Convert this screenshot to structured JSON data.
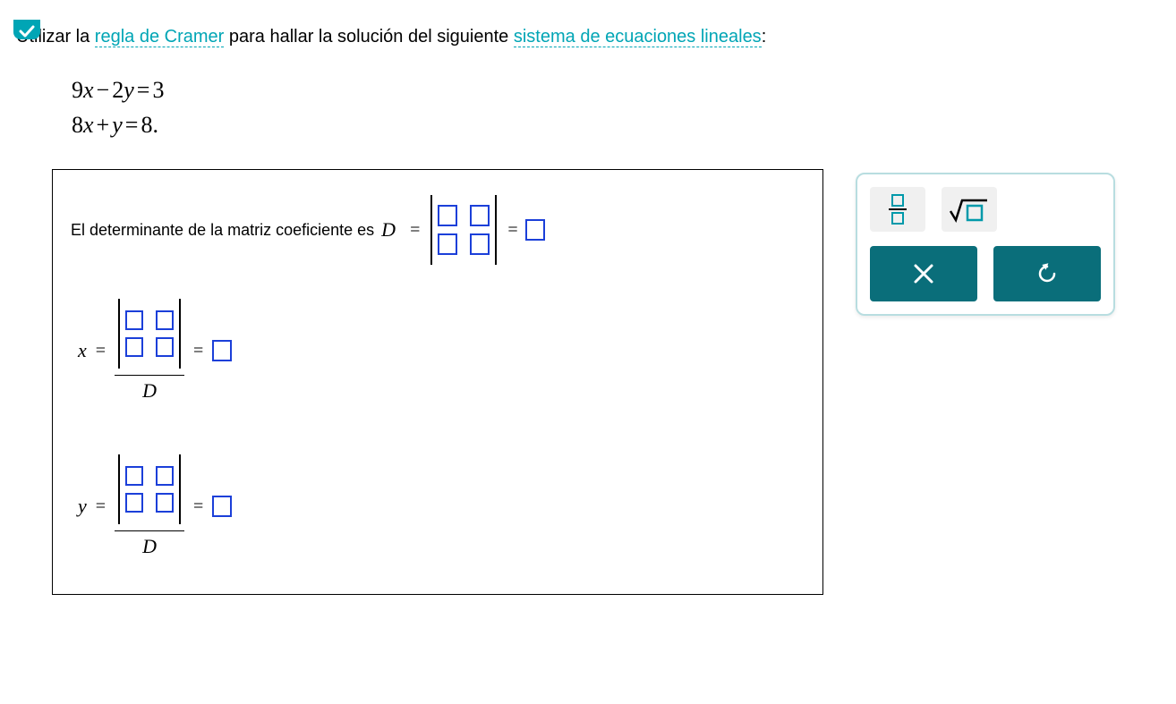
{
  "question": {
    "prefix": "Utilizar la ",
    "link1": "regla de Cramer",
    "mid": " para hallar la solución del siguiente ",
    "link2": "sistema de ecuaciones lineales",
    "suffix": ":"
  },
  "equations": {
    "eq1": {
      "c1": "9",
      "v1": "x",
      "op": "−",
      "c2": "2",
      "v2": "y",
      "eq": "=",
      "rhs": "3"
    },
    "eq2": {
      "c1": "8",
      "v1": "x",
      "op": "+",
      "c2": "",
      "v2": "y",
      "eq": "=",
      "rhs": "8",
      "end": "."
    }
  },
  "panel": {
    "det_label": "El determinante de la matriz coeficiente es",
    "D": "D",
    "eq": "=",
    "x_label": "x",
    "y_label": "y"
  },
  "tools": {
    "fraction_name": "fraction-tool",
    "sqrt_name": "square-root-tool",
    "close_name": "close-button",
    "reset_name": "reset-button"
  }
}
